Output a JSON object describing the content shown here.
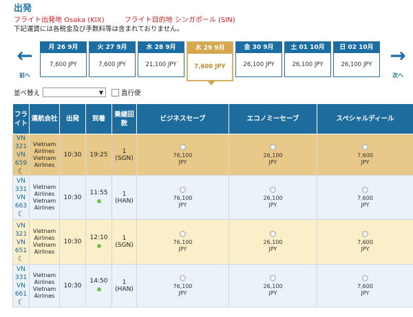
{
  "header": {
    "title": "出発",
    "origin": "フライト出発地 Osaka (KIX)",
    "destination": "フライト目的地 シンガポール (SIN)",
    "note": "下記運賃には各税金及び手数料等は含まれておりません。"
  },
  "nav": {
    "prev_label": "前へ",
    "next_label": "次へ"
  },
  "dates": [
    {
      "label": "月 26 9月",
      "price": "7,600 JPY"
    },
    {
      "label": "火 27 9月",
      "price": "7,600 JPY"
    },
    {
      "label": "水 28 9月",
      "price": "21,100 JPY"
    },
    {
      "label": "木 29 9月",
      "price": "7,600 JPY"
    },
    {
      "label": "金 30 9月",
      "price": "26,100 JPY"
    },
    {
      "label": "土 01 10月",
      "price": "26,100 JPY"
    },
    {
      "label": "日 02 10月",
      "price": "26,100 JPY"
    }
  ],
  "filters": {
    "sort_label": "並べ替え",
    "sort_value": "",
    "direct_label": "直行便"
  },
  "table": {
    "headers": [
      "フライト",
      "運航会社",
      "出発",
      "到着",
      "乗継回数",
      "ビジネスセーブ",
      "エコノミーセーブ",
      "スペシャルディール"
    ],
    "rows": [
      {
        "flights": [
          "VN",
          "321",
          "VN",
          "659"
        ],
        "airline": [
          "Vietnam",
          "Airlines",
          "Vietnam",
          "Airlines"
        ],
        "dep": "10:30",
        "arr": "19:25",
        "stops": "1",
        "via": "(SGN)",
        "biz": [
          "76,100",
          "JPY"
        ],
        "eco": [
          "26,100",
          "JPY"
        ],
        "spe": [
          "7,600",
          "JPY"
        ]
      },
      {
        "flights": [
          "VN",
          "331",
          "VN",
          "663"
        ],
        "airline": [
          "Vietnam",
          "Airlines",
          "Vietnam",
          "Airlines"
        ],
        "dep": "10:30",
        "arr": "11:55",
        "stops": "1",
        "via": "(HAN)",
        "biz": [
          "76,100",
          "JPY"
        ],
        "eco": [
          "26,100",
          "JPY"
        ],
        "spe": [
          "7,600",
          "JPY"
        ]
      },
      {
        "flights": [
          "VN",
          "321",
          "VN",
          "651"
        ],
        "airline": [
          "Vietnam",
          "Airlines",
          "Vietnam",
          "Airlines"
        ],
        "dep": "10:30",
        "arr": "12:10",
        "stops": "1",
        "via": "(SGN)",
        "biz": [
          "76,100",
          "JPY"
        ],
        "eco": [
          "26,100",
          "JPY"
        ],
        "spe": [
          "7,600",
          "JPY"
        ]
      },
      {
        "flights": [
          "VN",
          "331",
          "VN",
          "661"
        ],
        "airline": [
          "Vietnam",
          "Airlines",
          "Vietnam",
          "Airlines"
        ],
        "dep": "10:30",
        "arr": "14:50",
        "stops": "1",
        "via": "(HAN)",
        "biz": [
          "76,100",
          "JPY"
        ],
        "eco": [
          "26,100",
          "JPY"
        ],
        "spe": [
          "7,600",
          "JPY"
        ]
      }
    ]
  }
}
